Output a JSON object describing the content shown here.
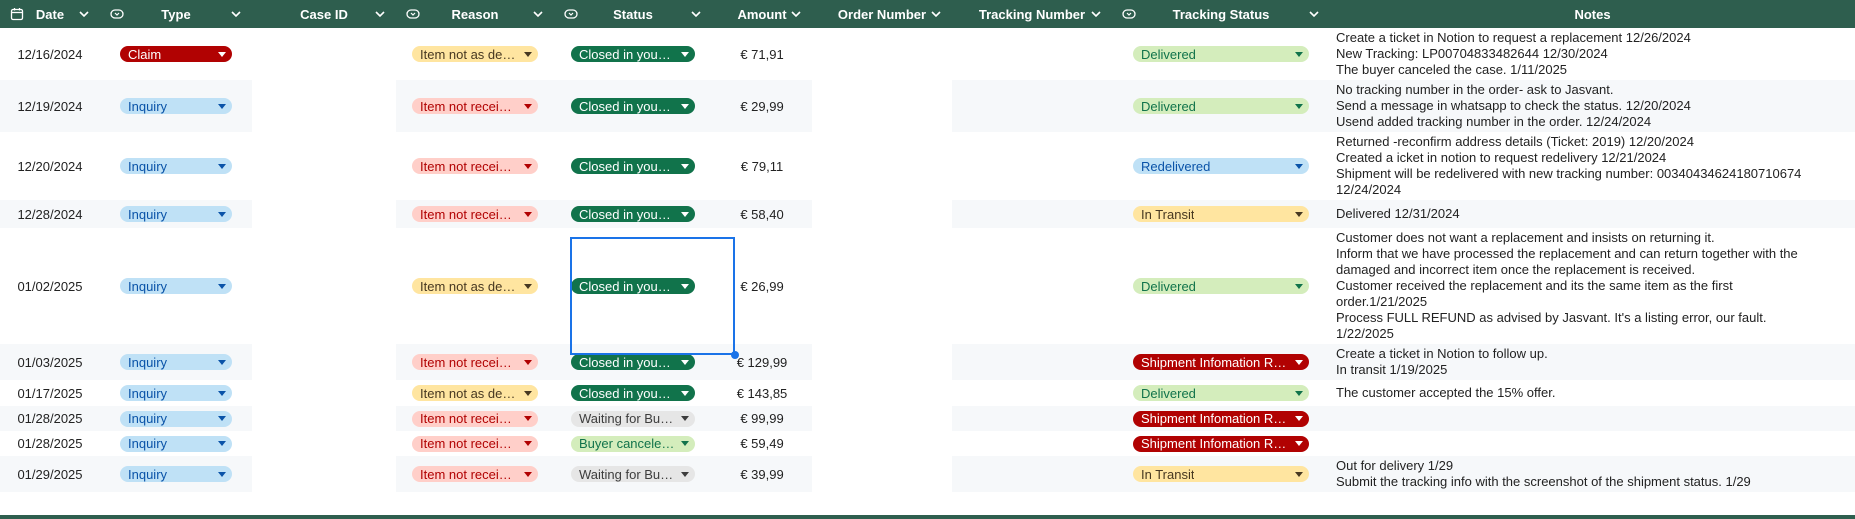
{
  "headers": {
    "date": "Date",
    "type": "Type",
    "case_id": "Case ID",
    "reason": "Reason",
    "status": "Status",
    "amount": "Amount",
    "order_number": "Order Number",
    "tracking_number": "Tracking Number",
    "tracking_status": "Tracking Status",
    "notes": "Notes"
  },
  "icons": {
    "calendar": "calendar-icon",
    "dropdown_type": "dropdown-chip-icon",
    "chevron": "chevron-down-icon"
  },
  "colors": {
    "header_bg": "#2e5e4e",
    "selection": "#1a73e8"
  },
  "rows": [
    {
      "date": "12/16/2024",
      "type": "Claim",
      "reason": "Item not as describe",
      "status": "Closed in your favor",
      "amount": "€ 71,91",
      "tracking_status": "Delivered",
      "notes": [
        "Create a ticket in Notion to request a replacement 12/26/2024",
        "New Tracking: LP00704833482644 12/30/2024",
        "The buyer canceled the case. 1/11/2025"
      ]
    },
    {
      "date": "12/19/2024",
      "type": "Inquiry",
      "reason": "Item not received",
      "status": "Closed in your favor",
      "amount": "€ 29,99",
      "tracking_status": "Delivered",
      "notes": [
        "No tracking number in the order- ask to Jasvant.",
        "Send a message in whatsapp to check the status. 12/20/2024",
        "Usend added tracking number in the order. 12/24/2024"
      ]
    },
    {
      "date": "12/20/2024",
      "type": "Inquiry",
      "reason": "Item not received",
      "status": "Closed in your favor",
      "amount": "€ 79,11",
      "tracking_status": "Redelivered",
      "notes": [
        "Returned -reconfirm address details (Ticket: 2019) 12/20/2024",
        "Created a icket in notion to request redelivery 12/21/2024",
        "Shipment will be redelivered with new tracking number: 00340434624180710674",
        "12/24/2024"
      ]
    },
    {
      "date": "12/28/2024",
      "type": "Inquiry",
      "reason": "Item not received",
      "status": "Closed in your favor",
      "amount": "€ 58,40",
      "tracking_status": "In Transit",
      "notes": [
        "Delivered 12/31/2024"
      ]
    },
    {
      "date": "01/02/2025",
      "type": "Inquiry",
      "reason": "Item not as describe",
      "status": "Closed in your favor",
      "amount": "€ 26,99",
      "tracking_status": "Delivered",
      "notes": [
        "Customer does not want a replacement and insists on returning it.",
        "Inform that we have processed the replacement and can return together with the",
        "damaged and incorrect item once the replacement is received.",
        "Customer received the replacement and its the same item as the first",
        "order.1/21/2025",
        "Process FULL REFUND as advised by Jasvant. It's a listing error, our fault.",
        "1/22/2025"
      ]
    },
    {
      "date": "01/03/2025",
      "type": "Inquiry",
      "reason": "Item not received",
      "status": "Closed in your favor",
      "amount": "€ 129,99",
      "tracking_status": "Shipment Infomation Received",
      "notes": [
        "Create a ticket in Notion to follow up.",
        "In transit 1/19/2025"
      ]
    },
    {
      "date": "01/17/2025",
      "type": "Inquiry",
      "reason": "Item not as describe",
      "status": "Closed in your favor",
      "amount": "€ 143,85",
      "tracking_status": "Delivered",
      "notes": [
        "The customer accepted the 15% offer."
      ]
    },
    {
      "date": "01/28/2025",
      "type": "Inquiry",
      "reason": "Item not received",
      "status": "Waiting for Buyer",
      "amount": "€ 99,99",
      "tracking_status": "Shipment Infomation Received",
      "notes": []
    },
    {
      "date": "01/28/2025",
      "type": "Inquiry",
      "reason": "Item not received",
      "status": "Buyer canceled th...",
      "amount": "€ 59,49",
      "tracking_status": "Shipment Infomation Received",
      "notes": []
    },
    {
      "date": "01/29/2025",
      "type": "Inquiry",
      "reason": "Item not received",
      "status": "Waiting for Buyer",
      "amount": "€ 39,99",
      "tracking_status": "In Transit",
      "notes": [
        "Out for delivery 1/29",
        "Submit the tracking info with the screenshot of the shipment status. 1/29"
      ]
    }
  ]
}
